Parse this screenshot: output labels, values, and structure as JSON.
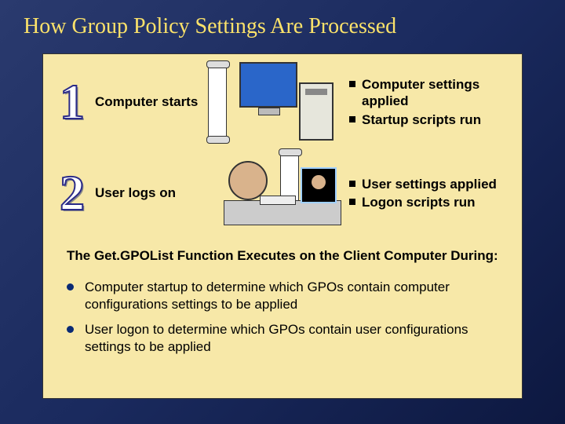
{
  "title": "How Group Policy Settings Are Processed",
  "steps": [
    {
      "number": "1",
      "label": "Computer starts",
      "points": [
        "Computer settings applied",
        "Startup scripts run"
      ]
    },
    {
      "number": "2",
      "label": "User  logs on",
      "points": [
        "User settings applied",
        "Logon scripts run"
      ]
    }
  ],
  "subhead": "The Get.GPOList Function Executes on the Client Computer During:",
  "details": [
    "Computer startup to determine which GPOs contain computer configurations settings to be applied",
    "User logon to determine which GPOs contain user configurations settings to be applied"
  ]
}
